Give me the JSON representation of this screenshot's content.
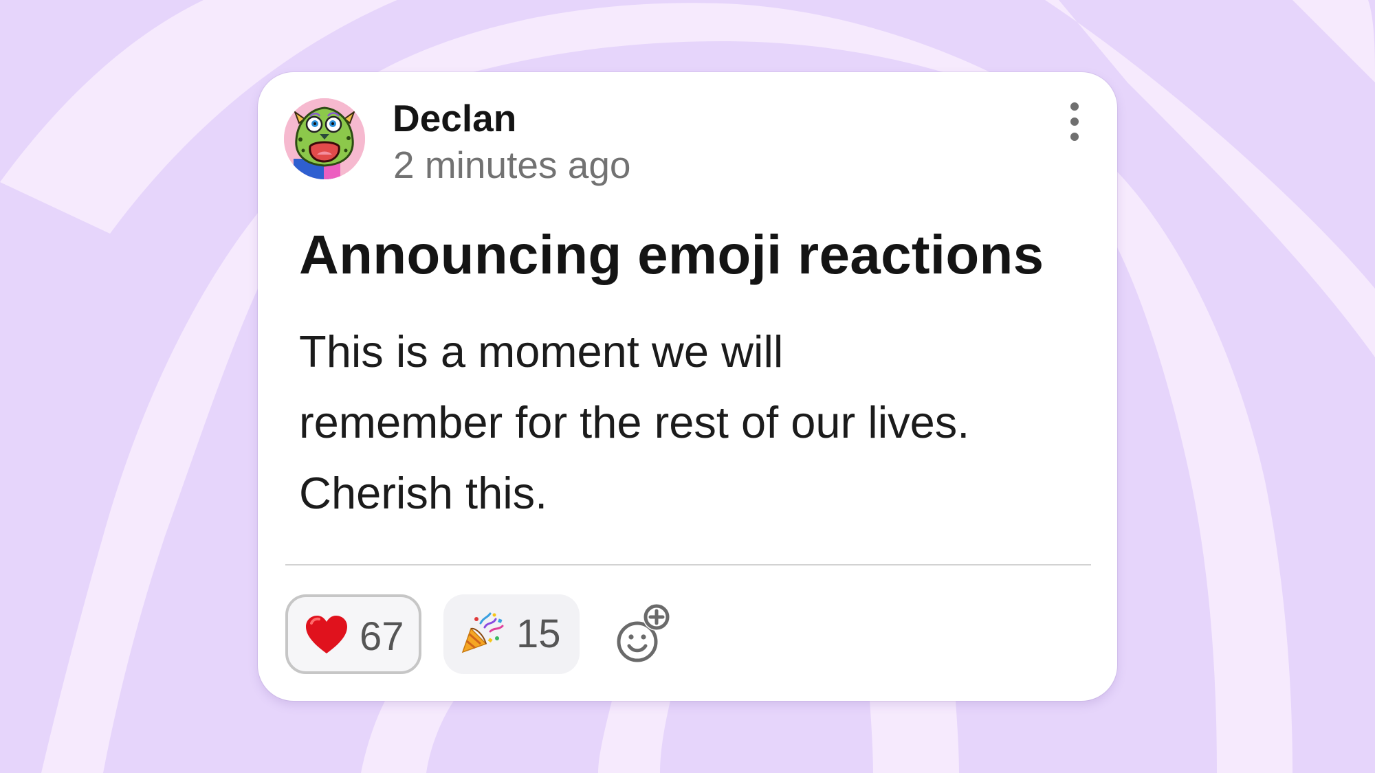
{
  "post": {
    "author": "Declan",
    "timestamp": "2 minutes ago",
    "title": "Announcing emoji reactions",
    "body_lines": [
      "This is a moment we will",
      "remember for the rest of our lives.",
      "Cherish this."
    ]
  },
  "reactions": [
    {
      "icon": "red-heart-icon",
      "count": "67",
      "selected": true
    },
    {
      "icon": "party-popper-icon",
      "count": "15",
      "selected": false
    }
  ],
  "colors": {
    "background": "#e6d5fb",
    "background_arcs": "#f6eafd",
    "card": "#ffffff",
    "avatar_bg": "#f6b9cf",
    "heart": "#e0121d"
  }
}
